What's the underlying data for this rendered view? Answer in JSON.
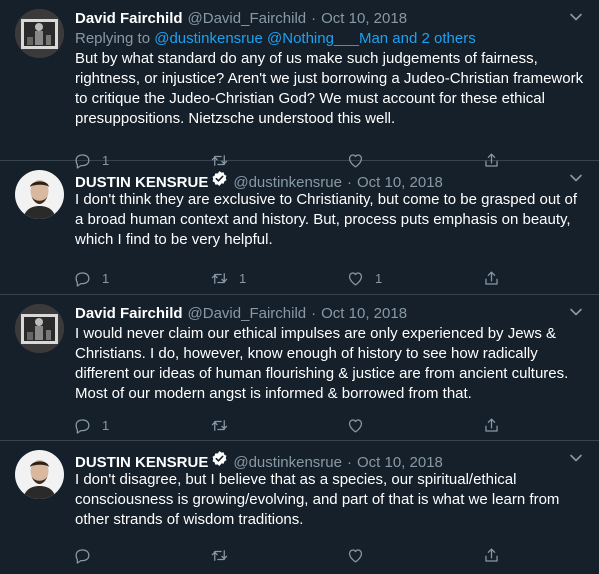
{
  "tweets": [
    {
      "name": "David Fairchild",
      "handle": "@David_Fairchild",
      "date": "Oct 10, 2018",
      "verified": false,
      "reply_prefix": "Replying to ",
      "reply_to": "@dustinkensrue @Nothing___Man and 2 others",
      "text": "But by what standard do any of us make such judgements of fairness, rightness, or injustice? Aren't we just borrowing a Judeo-Christian framework to critique the Judeo-Christian God? We must account for these ethical presuppositions. Nietzsche understood this well.",
      "reply_count": "1",
      "retweet_count": "",
      "like_count": ""
    },
    {
      "name": "DUSTIN KENSRUE",
      "handle": "@dustinkensrue",
      "date": "Oct 10, 2018",
      "verified": true,
      "text": "I don't think they are exclusive to Christianity, but come to be grasped out of a broad human context and history. But, process puts emphasis on beauty, which I find to be very helpful.",
      "reply_count": "1",
      "retweet_count": "1",
      "like_count": "1"
    },
    {
      "name": "David Fairchild",
      "handle": "@David_Fairchild",
      "date": "Oct 10, 2018",
      "verified": false,
      "text": "I would never claim our ethical impulses are only experienced by Jews & Christians. I do, however, know enough of history to see how radically different our ideas of human flourishing & justice are from ancient cultures. Most of our modern angst is informed & borrowed from that.",
      "reply_count": "1",
      "retweet_count": "",
      "like_count": ""
    },
    {
      "name": "DUSTIN KENSRUE",
      "handle": "@dustinkensrue",
      "date": "Oct 10, 2018",
      "verified": true,
      "text": "I don't disagree, but I believe that as a species, our spiritual/ethical consciousness is growing/evolving, and part of that is what we learn from other strands of wisdom traditions.",
      "reply_count": "",
      "retweet_count": "",
      "like_count": ""
    }
  ],
  "dot_separator": "·",
  "colors": {
    "background": "#15202b",
    "secondary_text": "#8899a6",
    "link": "#1da1f2",
    "divider": "#38444d"
  },
  "icons": [
    "reply-icon",
    "retweet-icon",
    "like-icon",
    "share-icon",
    "chevron-down-icon",
    "verified-badge-icon"
  ]
}
